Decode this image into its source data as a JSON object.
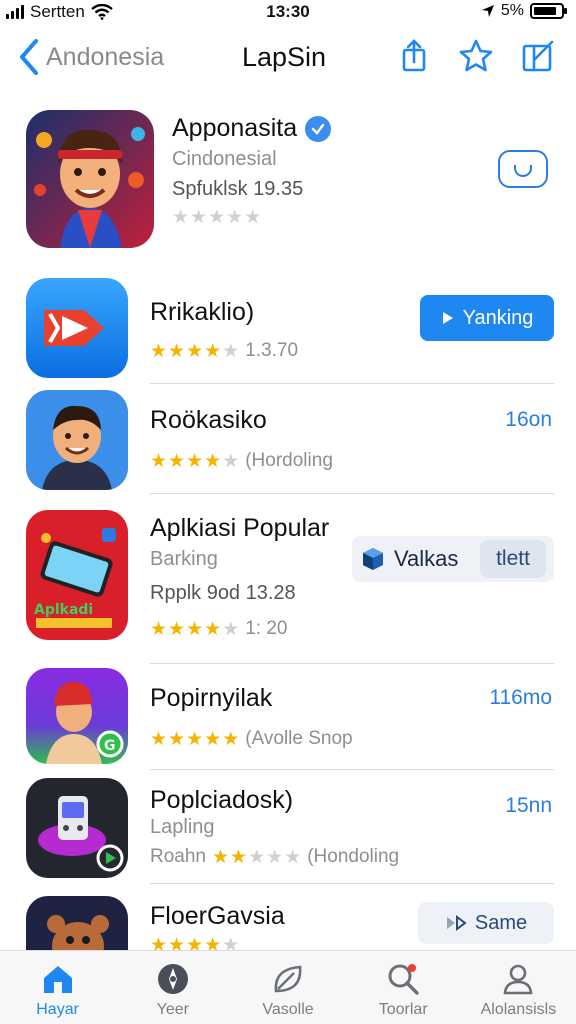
{
  "status_bar": {
    "carrier": "Sertten",
    "time": "13:30",
    "battery": "5%"
  },
  "nav": {
    "back_label": "Andonesia",
    "title": "LapSin"
  },
  "featured": {
    "name": "Apponasita",
    "subtitle": "Cindonesial",
    "meta": "Spfuklsk 19.35",
    "rating": 0,
    "accent": "#2a7de1"
  },
  "apps": [
    {
      "name": "Rrikaklio)",
      "subtitle": "",
      "meta": "",
      "rating": 3.5,
      "rating_text": "1.3.70",
      "size": "",
      "action_label": "Yanking",
      "action_type": "blue"
    },
    {
      "name": "Roökasiko",
      "subtitle": "",
      "meta": "",
      "rating": 4,
      "rating_text": "(Hordoling",
      "size": "16on",
      "action_label": "",
      "action_type": "none"
    },
    {
      "name": "Aplkiasi Popular",
      "subtitle": "Barking",
      "meta": "Rpplk 9od  13.28",
      "rating": 4,
      "rating_text": "1: 20",
      "size": "",
      "action_label": "Valkas",
      "action_label_2": "tlett",
      "action_type": "split"
    },
    {
      "name": "Popirnyilak",
      "subtitle": "",
      "meta": "",
      "rating": 4.5,
      "rating_text": "(Avolle Snop",
      "size": "116mo",
      "action_label": "",
      "action_type": "none"
    },
    {
      "name": "Poplciadosk)",
      "subtitle": "Lapling",
      "meta": "",
      "rating": 2,
      "rating_prefix": "Roahn",
      "rating_text": "(Hondoling",
      "size": "15nn",
      "action_label": "",
      "action_type": "none"
    },
    {
      "name": "FloerGavsia",
      "subtitle": "",
      "meta": "",
      "rating": 4,
      "rating_text": "",
      "size": "",
      "action_label": "Same",
      "action_type": "grey"
    }
  ],
  "tabs": [
    {
      "label": "Hayar",
      "icon": "home-icon",
      "active": true
    },
    {
      "label": "Yeer",
      "icon": "compass-icon",
      "active": false
    },
    {
      "label": "Vasolle",
      "icon": "leaf-icon",
      "active": false
    },
    {
      "label": "Toorlar",
      "icon": "search-icon",
      "active": false
    },
    {
      "label": "Alolansisls",
      "icon": "person-icon",
      "active": false
    }
  ],
  "colors": {
    "accent": "#1e88f0",
    "star": "#f5b400"
  }
}
